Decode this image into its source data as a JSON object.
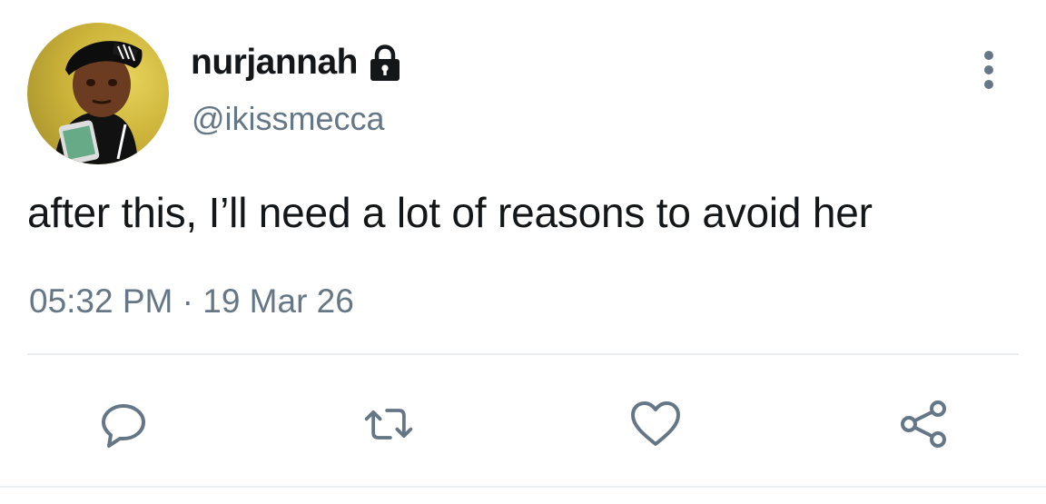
{
  "tweet": {
    "author": {
      "display_name": "nurjannah",
      "handle": "@ikissmecca",
      "protected": true,
      "avatar_icon": "user-avatar"
    },
    "text": "after this, I’ll need a lot of reasons to avoid her",
    "timestamp": "05:32 PM · 19 Mar 26",
    "actions": [
      {
        "name": "reply",
        "icon": "reply-icon"
      },
      {
        "name": "retweet",
        "icon": "retweet-icon"
      },
      {
        "name": "like",
        "icon": "heart-icon"
      },
      {
        "name": "share",
        "icon": "share-icon"
      }
    ]
  },
  "colors": {
    "text_primary": "#14171a",
    "text_secondary": "#657786",
    "divider": "#e6ecf0"
  }
}
